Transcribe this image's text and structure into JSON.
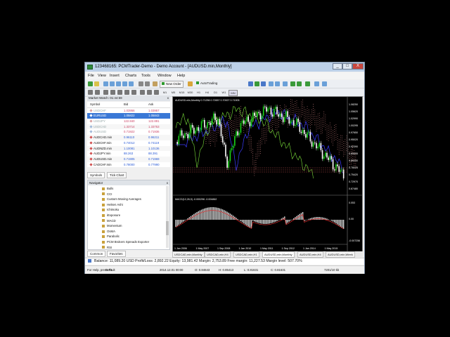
{
  "window": {
    "title": "123468165: PCMTrader-Demo - Demo Account - [AUDUSD.min,Monthly]",
    "controls": [
      "_",
      "□",
      "X"
    ]
  },
  "menu": [
    "File",
    "View",
    "Insert",
    "Charts",
    "Tools",
    "Window",
    "Help"
  ],
  "toolbar": {
    "new_order": "New Order",
    "autotrading": "AutoTrading",
    "timeframes": [
      "M1",
      "M5",
      "M15",
      "M30",
      "H1",
      "H4",
      "D1",
      "W1",
      "MN"
    ]
  },
  "market_watch": {
    "title": "Market Watch: 01:44:59",
    "columns": [
      "Symbol",
      "Bid",
      "Ask"
    ],
    "rows": [
      {
        "symbol": "USDCHF",
        "bid": "1.03956",
        "ask": "1.03957",
        "icon_color": "#d9a0a0"
      },
      {
        "symbol": "EURUSD",
        "bid": "1.05822",
        "ask": "1.05843",
        "icon_color": "#ffffff",
        "selected": true
      },
      {
        "symbol": "USDJPY",
        "bid": "122.840",
        "ask": "122.891",
        "icon_color": "#d9a0a0"
      },
      {
        "symbol": "USDCAD",
        "bid": "1.33714",
        "ask": "1.33753",
        "icon_color": "#a0b8d9"
      },
      {
        "symbol": "AUDUSD",
        "bid": "0.71922",
        "ask": "0.71936",
        "icon_color": "#a0b8d9"
      },
      {
        "symbol": "AUDCAD.min",
        "bid": "0.96110",
        "ask": "0.96211",
        "icon_color": "#d05050"
      },
      {
        "symbol": "AUDCHF.min",
        "bid": "0.74012",
        "ask": "0.74119",
        "icon_color": "#d05050"
      },
      {
        "symbol": "AUDNZD.min",
        "bid": "1.10081",
        "ask": "1.10136",
        "icon_color": "#d05050"
      },
      {
        "symbol": "AUDJPY.min",
        "bid": "88.263",
        "ask": "88.391",
        "icon_color": "#d05050"
      },
      {
        "symbol": "AUDUSD.min",
        "bid": "0.71905",
        "ask": "0.71969",
        "icon_color": "#d05050"
      },
      {
        "symbol": "CADCHF.min",
        "bid": "0.78000",
        "ask": "0.77990",
        "icon_color": "#d05050"
      }
    ],
    "tabs": [
      "Symbols",
      "Tick Chart"
    ]
  },
  "navigator": {
    "title": "Navigator",
    "items": [
      "Bulls",
      "CCI",
      "Custom Moving Averages",
      "Heiken Ashi",
      "Ichimoku",
      "iExposure",
      "MACD",
      "Momentum",
      "OsMA",
      "Parabolic",
      "PCM Brokers Spreads Exporter",
      "RSI"
    ],
    "tabs": [
      "Common",
      "Favorites"
    ]
  },
  "chart": {
    "header": "AUDUSD.min,Monthly 0.71256 0.72657 0.70927 0.71905",
    "price_labels": [
      "1.08250",
      "1.05620",
      "1.02990",
      "1.00295",
      "0.97650",
      "0.95020",
      "0.92390",
      "0.89695",
      "0.85050",
      "0.78025",
      "0.75420",
      "0.72970",
      "0.67480"
    ],
    "macd_header": "MACD(12,26,9) -0.000296 -0.004862",
    "macd_labels": [
      "0.053",
      "0.00",
      "-0.007256"
    ],
    "date_labels": [
      "1 Jan 2006",
      "1 May 2007",
      "1 Sep 2008",
      "1 Jan 2010",
      "1 May 2011",
      "1 Sep 2012",
      "1 Jan 2014",
      "1 May 2015"
    ],
    "tabs": [
      "USDCAD,min,Monthly",
      "USDCAD,min,H4",
      "USDCAD,min,H1",
      "AUDUSD,min,Monthly",
      "AUDUSD,min,H4",
      "AUDUSD,min,Week"
    ]
  },
  "terminal_line": "Balance: 11,089.20 USD  Profit/Loss: 2,892.22  Equity: 13,981.42  Margin: 2,753.89  Free margin: 11,227.53  Margin level: 507.70%",
  "statusbar": {
    "help": "For Help, press F1",
    "profile": "Default",
    "datetime": "2014.12.01 00:00",
    "open": "O: 0.84643",
    "high": "H: 0.85413",
    "low": "L: 0.81631",
    "close": "C: 0.81631",
    "traffic": "7201/10 kb"
  },
  "colors": {
    "titlebar": "#bcd0e8",
    "chart_bg": "#000000",
    "bull_candle": "#19d519",
    "bear_candle": "#ffffff",
    "ichimoku_cloud": "#d08080",
    "kijun_line": "#3b3bff"
  }
}
